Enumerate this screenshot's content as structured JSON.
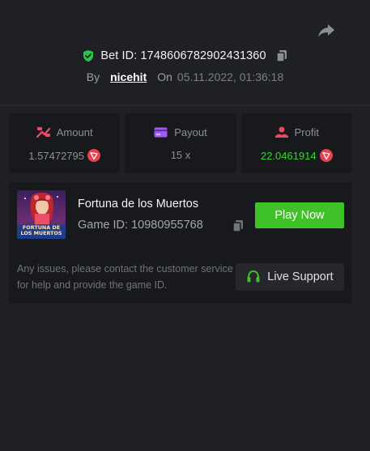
{
  "header": {
    "share_icon": "share-arrow-icon",
    "bet_label": "Bet ID:",
    "bet_id": "1748606782902431360",
    "by_label": "By",
    "username": "nicehit",
    "on_label": "On",
    "date": "05.11.2022, 01:36:18"
  },
  "stats": [
    {
      "label": "Amount",
      "value": "1.57472795",
      "icon": "amount-icon",
      "coin": "tron-coin-icon"
    },
    {
      "label": "Payout",
      "value": "15 x",
      "icon": "payout-card-icon"
    },
    {
      "label": "Profit",
      "value": "22.0461914",
      "icon": "profit-icon",
      "coin": "tron-coin-icon"
    }
  ],
  "game": {
    "title": "Fortuna de los Muertos",
    "id_label": "Game ID:",
    "id": "10980955768",
    "thumb_text": "FORTUNA DE LOS MUERTOS",
    "play_label": "Play Now"
  },
  "support": {
    "text": "Any issues, please contact the customer service for help and provide the game ID.",
    "button_label": "Live Support"
  },
  "colors": {
    "background": "#1e2024",
    "card": "#18191d",
    "accent_green": "#3ec228",
    "profit_green": "#37d72b",
    "coin_red": "#e8404e"
  }
}
